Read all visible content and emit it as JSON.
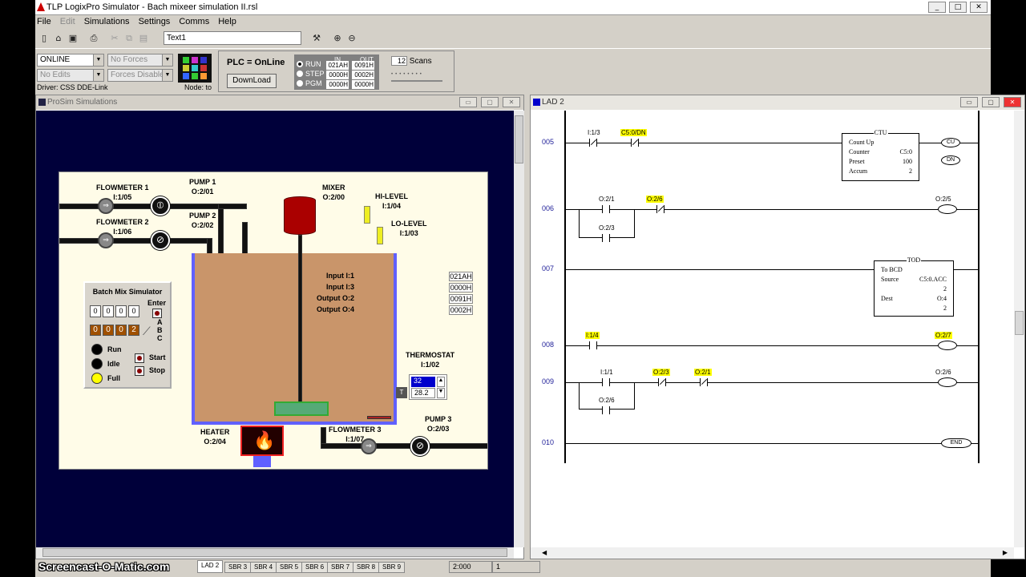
{
  "app": {
    "title": "TLP LogixPro Simulator  -  Bach mixeer simulation II.rsl",
    "min": "_",
    "max": "□",
    "close": "✕"
  },
  "menu": [
    "File",
    "Edit",
    "Simulations",
    "Settings",
    "Comms",
    "Help"
  ],
  "toolbar": {
    "text_field": "Text1"
  },
  "status": {
    "mode_combo": "ONLINE",
    "forces_combo": "No Forces",
    "edits_combo": "No Edits",
    "forces_disabled_combo": "Forces Disabled",
    "driver": "Driver: CSS DDE-Link",
    "node": "Node: to",
    "plc_state": "PLC = OnLine",
    "download_label": "DownLoad",
    "modes": [
      "RUN",
      "STEP",
      "PGM"
    ],
    "in_header": "IN",
    "out_header": "OUT",
    "in_values": [
      "021AH",
      "0000H",
      "0000H"
    ],
    "out_values": [
      "0091H",
      "0002H",
      "0000H"
    ],
    "scans_value": "12",
    "scans_label": "Scans"
  },
  "prosim": {
    "title": "ProSim Simulations",
    "labels": {
      "flowmeter1": "FLOWMETER 1",
      "flowmeter1_addr": "I:1/05",
      "flowmeter2": "FLOWMETER 2",
      "flowmeter2_addr": "I:1/06",
      "pump1": "PUMP 1",
      "pump1_addr": "O:2/01",
      "pump2": "PUMP 2",
      "pump2_addr": "O:2/02",
      "mixer": "MIXER",
      "mixer_addr": "O:2/00",
      "hilevel": "HI-LEVEL",
      "hilevel_addr": "I:1/04",
      "lolevel": "LO-LEVEL",
      "lolevel_addr": "I:1/03",
      "thermostat": "THERMOSTAT",
      "thermostat_addr": "I:1/02",
      "heater": "HEATER",
      "heater_addr": "O:2/04",
      "flowmeter3": "FLOWMETER 3",
      "flowmeter3_addr": "I:1/07",
      "pump3": "PUMP 3",
      "pump3_addr": "O:2/03"
    },
    "io": [
      {
        "label": "Input I:1",
        "value": "021AH"
      },
      {
        "label": "Input I:3",
        "value": "0000H"
      },
      {
        "label": "Output O:2",
        "value": "0091H"
      },
      {
        "label": "Output O:4",
        "value": "0002H"
      }
    ],
    "thermostat_set": "32",
    "thermostat_temp": "28.2",
    "thermostat_t": "T",
    "batch": {
      "title": "Batch Mix Simulator",
      "enter": "Enter",
      "thumbwheel": [
        "0",
        "0",
        "0",
        "0"
      ],
      "counter": [
        "0",
        "0",
        "0",
        "2"
      ],
      "abc": [
        "A",
        "B",
        "C"
      ],
      "run": "Run",
      "idle": "Idle",
      "full": "Full",
      "start": "Start",
      "stop": "Stop"
    }
  },
  "lad": {
    "title": "LAD 2",
    "rungs": [
      {
        "num": "005",
        "contacts": [
          {
            "tag": "I:1/3",
            "hl": false
          },
          {
            "tag": "C5:0/DN",
            "hl": true
          }
        ],
        "ctu": {
          "title": "CTU",
          "name": "Count Up",
          "counter_label": "Counter",
          "counter": "C5:0",
          "preset_label": "Preset",
          "preset": "100",
          "accum_label": "Accum",
          "accum": "2",
          "cu": "CU",
          "dn": "DN"
        }
      },
      {
        "num": "006",
        "contacts": [
          {
            "tag": "O:2/1",
            "hl": false
          },
          {
            "tag": "O:2/6",
            "hl": true
          }
        ],
        "branch": "O:2/3",
        "coil": "O:2/5"
      },
      {
        "num": "007",
        "tod": {
          "title": "TOD",
          "name": "To BCD",
          "source_label": "Source",
          "source": "C5:0.ACC",
          "source_val": "2",
          "dest_label": "Dest",
          "dest": "O:4",
          "dest_val": "2"
        }
      },
      {
        "num": "008",
        "contacts": [
          {
            "tag": "I:1/4",
            "hl": true
          }
        ],
        "coil": "O:2/7",
        "coil_hl": true
      },
      {
        "num": "009",
        "contacts": [
          {
            "tag": "I:1/1",
            "hl": false
          },
          {
            "tag": "O:2/3",
            "hl": true
          },
          {
            "tag": "O:2/1",
            "hl": true
          }
        ],
        "branch": "O:2/6",
        "coil": "O:2/6"
      },
      {
        "num": "010",
        "end": "END"
      }
    ]
  },
  "tabs": [
    "LAD 2",
    "SBR 3",
    "SBR 4",
    "SBR 5",
    "SBR 6",
    "SBR 7",
    "SBR 8",
    "SBR 9"
  ],
  "status_bar": {
    "pos": "2:000",
    "val": "1"
  },
  "watermark": "Screencast-O-Matic.com"
}
